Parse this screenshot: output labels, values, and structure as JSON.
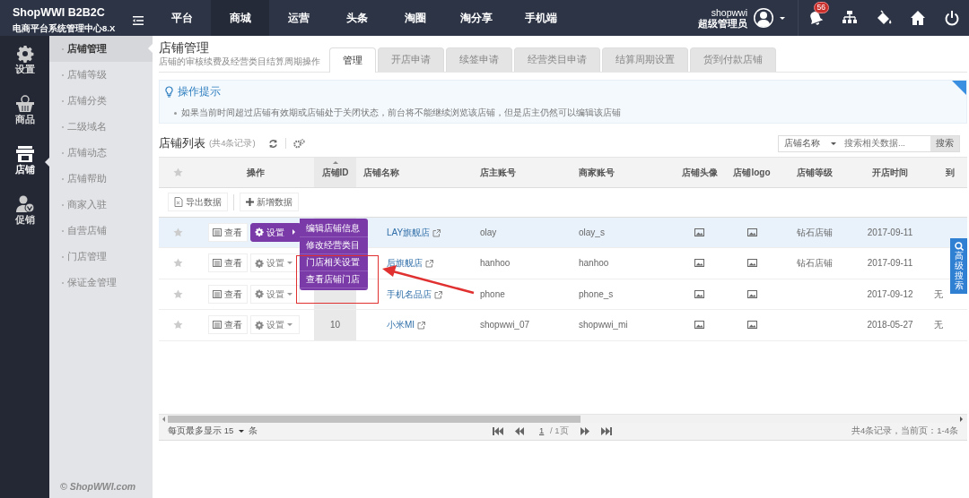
{
  "brand": {
    "title": "ShopWWI B2B2C",
    "subtitle": "电商平台系统管理中心8.X"
  },
  "top_nav": [
    {
      "label": "平台",
      "selected": false
    },
    {
      "label": "商城",
      "selected": true
    },
    {
      "label": "运营",
      "selected": false
    },
    {
      "label": "头条",
      "selected": false
    },
    {
      "label": "淘圈",
      "selected": false
    },
    {
      "label": "淘分享",
      "selected": false
    },
    {
      "label": "手机端",
      "selected": false
    }
  ],
  "user": {
    "name": "shopwwi",
    "role": "超级管理员"
  },
  "notifications": {
    "count": "56"
  },
  "side_nav": [
    {
      "label": "设置",
      "kind": "gear",
      "selected": false
    },
    {
      "label": "商品",
      "kind": "basket",
      "selected": false
    },
    {
      "label": "店铺",
      "kind": "store",
      "selected": true
    },
    {
      "label": "促销",
      "kind": "member",
      "selected": false
    }
  ],
  "sub_nav": [
    {
      "label": "店铺管理",
      "selected": true
    },
    {
      "label": "店铺等级",
      "selected": false
    },
    {
      "label": "店铺分类",
      "selected": false
    },
    {
      "label": "二级域名",
      "selected": false
    },
    {
      "label": "店铺动态",
      "selected": false
    },
    {
      "label": "店铺帮助",
      "selected": false
    },
    {
      "label": "商家入驻",
      "selected": false
    },
    {
      "label": "自营店铺",
      "selected": false
    },
    {
      "label": "门店管理",
      "selected": false
    },
    {
      "label": "保证金管理",
      "selected": false
    }
  ],
  "sidebar_footer": "© ShopWWI.com",
  "page": {
    "title": "店铺管理",
    "subtitle": "店铺的审核续费及经营类目结算周期操作"
  },
  "tabs": [
    {
      "label": "管理",
      "selected": true
    },
    {
      "label": "开店申请",
      "selected": false
    },
    {
      "label": "续签申请",
      "selected": false
    },
    {
      "label": "经营类目申请",
      "selected": false
    },
    {
      "label": "结算周期设置",
      "selected": false
    },
    {
      "label": "货到付款店铺",
      "selected": false
    }
  ],
  "tips": {
    "title": "操作提示",
    "items": [
      "如果当前时间超过店铺有效期或店铺处于关闭状态，前台将不能继续浏览该店铺，但是店主仍然可以编辑该店铺"
    ]
  },
  "list": {
    "title": "店铺列表",
    "count": "(共4条记录)"
  },
  "search": {
    "field": "店铺名称",
    "placeholder": "搜索相关数据...",
    "button": "搜索"
  },
  "table": {
    "columns": [
      "操作",
      "店铺ID",
      "店铺名称",
      "店主账号",
      "商家账号",
      "店铺头像",
      "店铺logo",
      "店铺等级",
      "开店时间",
      "到"
    ],
    "toolbar": [
      "导出数据",
      "新增数据"
    ],
    "rows": [
      {
        "selected": true,
        "view": "查看",
        "settings": "设置",
        "settings_open": true,
        "name": "LAY旗舰店",
        "owner": "olay",
        "seller": "olay_s",
        "level": "钻石店铺",
        "opened": "2017-09-11"
      },
      {
        "selected": false,
        "view": "查看",
        "settings": "设置",
        "settings_open": false,
        "name": "后旗舰店",
        "owner": "hanhoo",
        "seller": "hanhoo",
        "level": "钻石店铺",
        "opened": "2017-09-11"
      },
      {
        "selected": false,
        "view": "查看",
        "settings": "设置",
        "settings_open": false,
        "name": "手机名品店",
        "owner": "phone",
        "seller": "phone_s",
        "opened": "2017-09-12",
        "expiry": "无"
      },
      {
        "selected": false,
        "view": "查看",
        "settings": "设置",
        "settings_open": false,
        "id": "10",
        "name": "小米MI",
        "owner": "shopwwi_07",
        "seller": "shopwwi_mi",
        "opened": "2018-05-27",
        "expiry": "无"
      }
    ],
    "dropdown": [
      "编辑店铺信息",
      "修改经营类目",
      "门店相关设置",
      "查看店铺门店"
    ]
  },
  "advanced_search": "高级搜索",
  "pagination": {
    "per_page_label": "每页最多显示",
    "per_page": "15",
    "unit": "条",
    "page": "1",
    "total": "/ 1页",
    "summary": "共4条记录，当前页：1-4条"
  }
}
